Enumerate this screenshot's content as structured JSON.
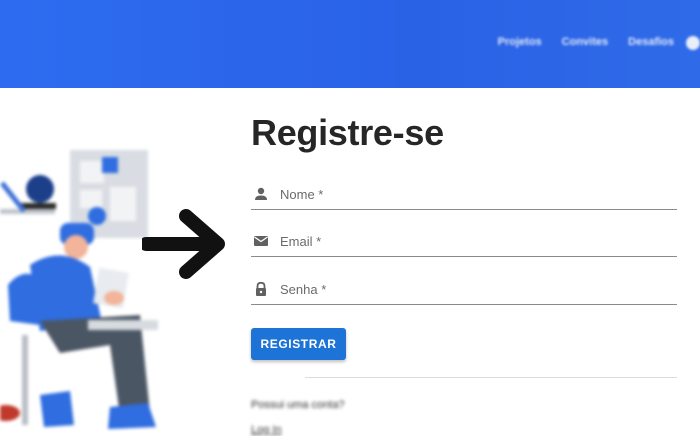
{
  "nav": {
    "items": [
      "Projetos",
      "Convites",
      "Desafios"
    ]
  },
  "form": {
    "title": "Registre-se",
    "name_label": "Nome *",
    "email_label": "Email *",
    "password_label": "Senha *",
    "submit_label": "REGISTRAR",
    "have_account_text": "Possui uma conta?",
    "login_link": "Log In"
  },
  "colors": {
    "header_blue": "#2d6cf0",
    "button_blue": "#1e73d6"
  },
  "icons": {
    "name": "person-icon",
    "email": "mail-icon",
    "password": "lock-icon",
    "arrow": "arrow-right-icon"
  }
}
